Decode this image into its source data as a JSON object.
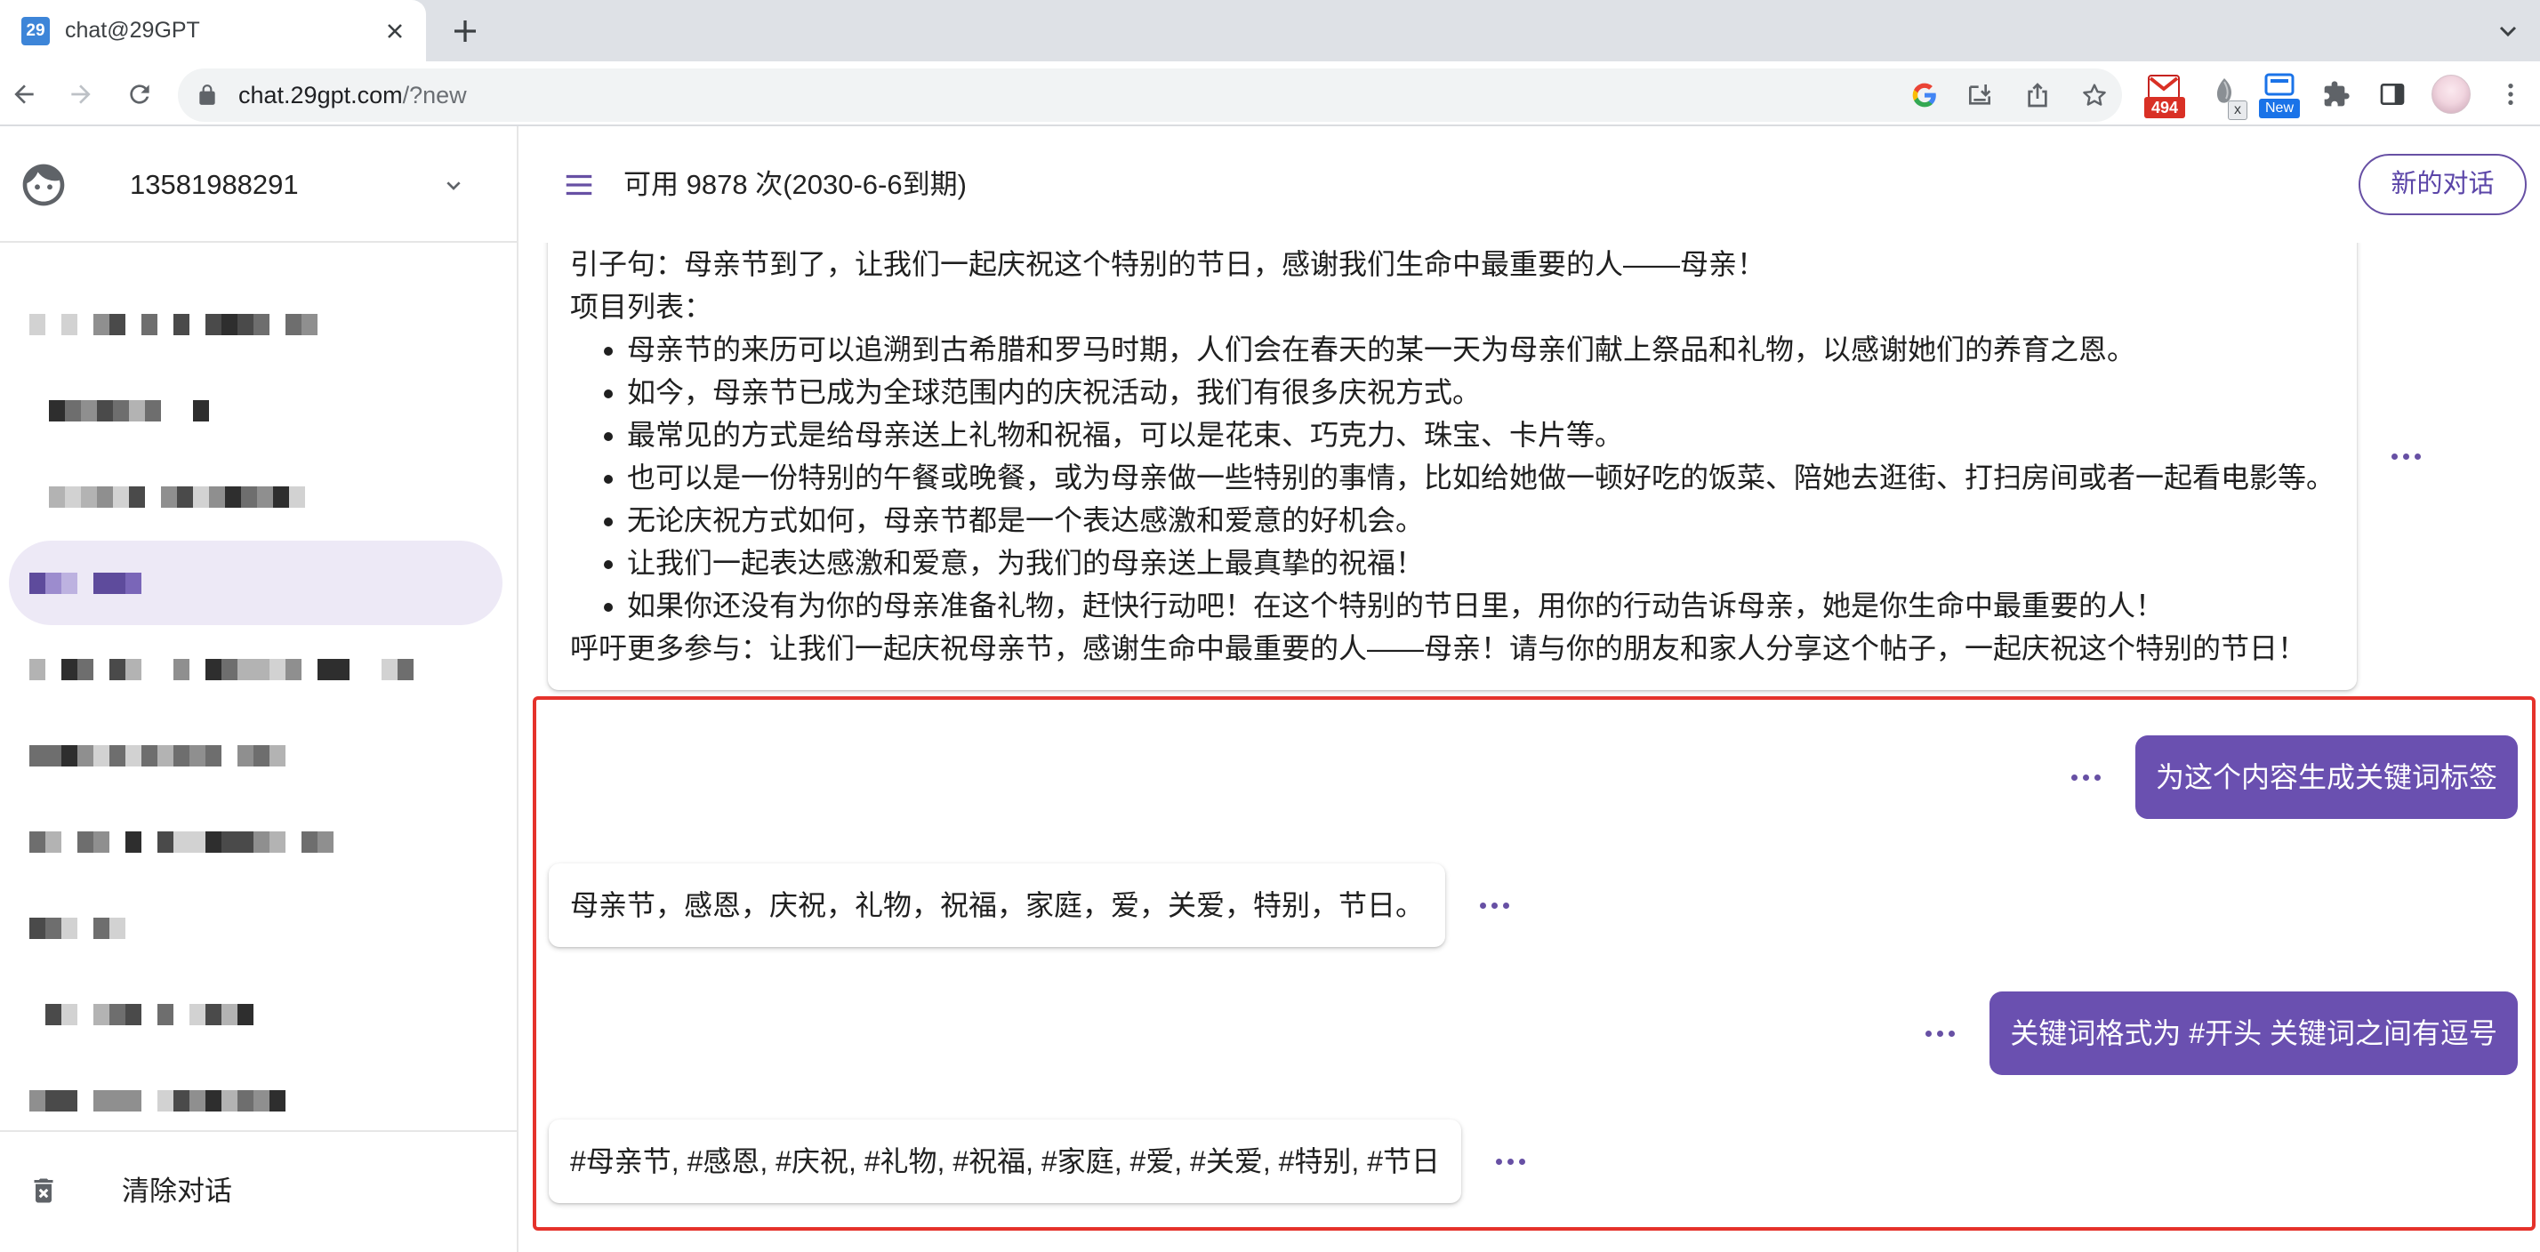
{
  "browser": {
    "tab": {
      "title": "chat@29GPT",
      "favicon_text": "29"
    },
    "address": {
      "host": "chat.29gpt.com",
      "path": "/?new"
    },
    "extensions": {
      "gmail_badge": "494",
      "x_badge": "x",
      "new_badge": "New"
    },
    "icons": [
      "back-icon",
      "forward-icon",
      "reload-icon",
      "lock-icon",
      "google-icon",
      "install-icon",
      "share-icon",
      "star-icon",
      "gmail-icon",
      "extension-icon",
      "new-extension-icon",
      "puzzle-icon",
      "side-panel-icon",
      "profile-avatar",
      "menu-icon"
    ]
  },
  "sidebar": {
    "account": "13581988291",
    "conversations": [
      {
        "selected": false
      },
      {
        "selected": false
      },
      {
        "selected": false
      },
      {
        "selected": true
      },
      {
        "selected": false
      },
      {
        "selected": false
      },
      {
        "selected": false
      },
      {
        "selected": false
      },
      {
        "selected": false
      },
      {
        "selected": false
      }
    ],
    "clear_label": "清除对话"
  },
  "header": {
    "quota": "可用 9878 次(2030-6-6到期)",
    "new_chat_label": "新的对话"
  },
  "colors": {
    "accent": "#6750a4",
    "user_bubble": "#6a50b0",
    "annotation": "#e5322b"
  },
  "messages": [
    {
      "role": "assistant",
      "intro": "引子句：母亲节到了，让我们一起庆祝这个特别的节日，感谢我们生命中最重要的人——母亲！",
      "list_title": "项目列表：",
      "bullets": [
        "母亲节的来历可以追溯到古希腊和罗马时期，人们会在春天的某一天为母亲们献上祭品和礼物，以感谢她们的养育之恩。",
        "如今，母亲节已成为全球范围内的庆祝活动，我们有很多庆祝方式。",
        "最常见的方式是给母亲送上礼物和祝福，可以是花束、巧克力、珠宝、卡片等。",
        "也可以是一份特别的午餐或晚餐，或为母亲做一些特别的事情，比如给她做一顿好吃的饭菜、陪她去逛街、打扫房间或者一起看电影等。",
        "无论庆祝方式如何，母亲节都是一个表达感激和爱意的好机会。",
        "让我们一起表达感激和爱意，为我们的母亲送上最真挚的祝福！",
        "如果你还没有为你的母亲准备礼物，赶快行动吧！在这个特别的节日里，用你的行动告诉母亲，她是你生命中最重要的人！"
      ],
      "closing": "呼吁更多参与：让我们一起庆祝母亲节，感谢生命中最重要的人——母亲！请与你的朋友和家人分享这个帖子，一起庆祝这个特别的节日！"
    },
    {
      "role": "user",
      "text": "为这个内容生成关键词标签"
    },
    {
      "role": "assistant",
      "text": "母亲节，感恩，庆祝，礼物，祝福，家庭，爱，关爱，特别，节日。"
    },
    {
      "role": "user",
      "text": "关键词格式为 #开头 关键词之间有逗号"
    },
    {
      "role": "assistant",
      "text": "#母亲节, #感恩, #庆祝, #礼物, #祝福, #家庭, #爱, #关爱, #特别, #节日"
    }
  ]
}
